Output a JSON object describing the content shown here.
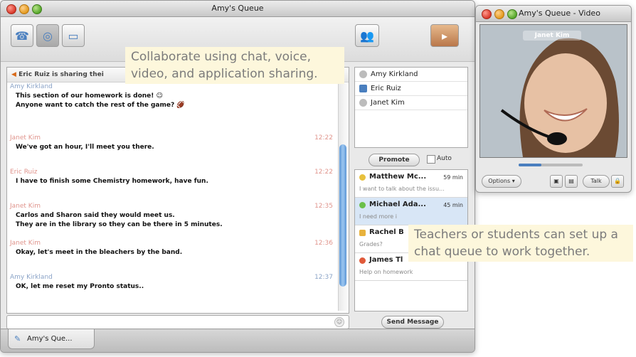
{
  "queue_window": {
    "title": "Amy's Queue",
    "toolbar": {
      "phone_icon": "phone-icon",
      "video_icon": "video-camera-icon",
      "share_icon": "application-share-icon",
      "users_icon": "users-icon"
    },
    "notice": "Eric Ruiz is sharing thei",
    "messages": [
      {
        "sender": "Amy Kirkland",
        "sender_color": "blue",
        "time": "",
        "lines": [
          "This section of our homework is done! ☺",
          "Anyone want to catch the rest of the game? 🏈"
        ]
      },
      {
        "sender": "Janet Kim",
        "sender_color": "red",
        "time": "12:22",
        "lines": [
          "We've got an hour, I'll meet you there."
        ]
      },
      {
        "sender": "Eric Ruiz",
        "sender_color": "red",
        "time": "12:22",
        "lines": [
          "I have to finish some Chemistry homework, have fun."
        ]
      },
      {
        "sender": "Janet Kim",
        "sender_color": "red",
        "time": "12:35",
        "lines": [
          "Carlos and Sharon said they would meet us.",
          "They are in the library so they can be there in 5 minutes."
        ]
      },
      {
        "sender": "Janet Kim",
        "sender_color": "red",
        "time": "12:36",
        "lines": [
          "Okay, let's meet in the bleachers by the band."
        ]
      },
      {
        "sender": "Amy Kirkland",
        "sender_color": "blue",
        "time": "12:37",
        "lines": [
          "OK, let me reset my Pronto status.."
        ]
      }
    ],
    "participants": [
      {
        "name": "Amy Kirkland"
      },
      {
        "name": "Eric Ruiz"
      },
      {
        "name": "Janet Kim"
      }
    ],
    "promote_label": "Promote",
    "auto_label": "Auto",
    "queue": [
      {
        "name": "Matthew Mc...",
        "wait": "59 min",
        "note": "I want to talk about the issu...",
        "color": "#e8c13d"
      },
      {
        "name": "Michael Ada...",
        "wait": "45 min",
        "note": "I need more i",
        "color": "#6cc04a"
      },
      {
        "name": "Rachel B",
        "wait": "",
        "note": "Grades?",
        "color": "#e8b23d"
      },
      {
        "name": "James Tl",
        "wait": "",
        "note": "Help on homework",
        "color": "#e05a3a"
      }
    ],
    "send_label": "Send Message",
    "tab_label": "Amy's Que..."
  },
  "video_window": {
    "title": "Amy's Queue - Video",
    "overlay_name": "Janet Kim",
    "options_label": "Options",
    "talk_label": "Talk"
  },
  "callouts": {
    "top": "Collaborate using chat, voice, video, and application sharing.",
    "bottom": "Teachers or students can set up a chat queue to work together."
  }
}
